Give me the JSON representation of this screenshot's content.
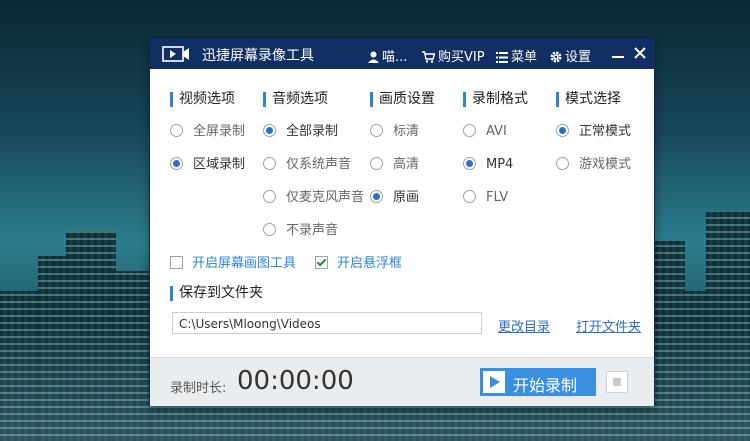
{
  "app": {
    "title": "迅捷屏幕录像工具"
  },
  "toolbar": {
    "user_label": "喵...",
    "buy_label": "购买VIP",
    "menu_label": "菜单",
    "settings_label": "设置"
  },
  "sections": {
    "video": {
      "title": "视频选项",
      "options": [
        {
          "label": "全屏录制",
          "selected": false
        },
        {
          "label": "区域录制",
          "selected": true
        }
      ]
    },
    "audio": {
      "title": "音频选项",
      "options": [
        {
          "label": "全部录制",
          "selected": true
        },
        {
          "label": "仅系统声音",
          "selected": false
        },
        {
          "label": "仅麦克风声音",
          "selected": false
        },
        {
          "label": "不录声音",
          "selected": false
        }
      ]
    },
    "quality": {
      "title": "画质设置",
      "options": [
        {
          "label": "标清",
          "selected": false
        },
        {
          "label": "高清",
          "selected": false
        },
        {
          "label": "原画",
          "selected": true
        }
      ]
    },
    "format": {
      "title": "录制格式",
      "options": [
        {
          "label": "AVI",
          "selected": false
        },
        {
          "label": "MP4",
          "selected": true
        },
        {
          "label": "FLV",
          "selected": false
        }
      ]
    },
    "mode": {
      "title": "模式选择",
      "options": [
        {
          "label": "正常模式",
          "selected": true
        },
        {
          "label": "游戏模式",
          "selected": false
        }
      ]
    }
  },
  "checkboxes": {
    "screen_tool": {
      "label": "开启屏幕画图工具",
      "checked": false
    },
    "float_frame": {
      "label": "开启悬浮框",
      "checked": true
    }
  },
  "save": {
    "title": "保存到文件夹",
    "path": "C:\\Users\\Mloong\\Videos",
    "change_label": "更改目录",
    "open_label": "打开文件夹"
  },
  "footer": {
    "duration_label": "录制时长:",
    "duration": "00:00:00",
    "start_label": "开始录制"
  },
  "colors": {
    "titlebar": "#112f63",
    "accent": "#3a8fe0",
    "section_bar": "#2e84d6"
  }
}
